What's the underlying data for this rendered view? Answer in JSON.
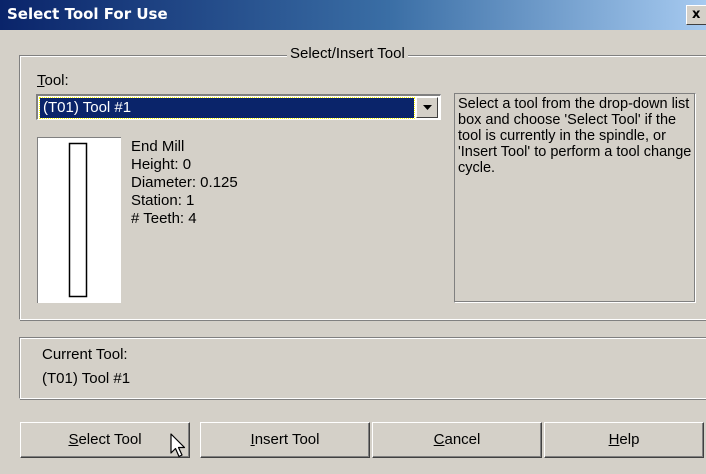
{
  "window": {
    "title": "Select Tool For Use",
    "close_glyph": "x"
  },
  "group": {
    "legend": "Select/Insert Tool"
  },
  "tool_field": {
    "label_mnemonic": "T",
    "label_rest": "ool:",
    "selected": "(T01) Tool #1"
  },
  "tool_info": {
    "type": "End Mill",
    "height": "Height: 0",
    "diameter": "Diameter: 0.125",
    "station": "Station: 1",
    "teeth": "# Teeth: 4"
  },
  "help_text": "Select a tool from the drop-down list box and choose 'Select Tool' if the tool is currently in the spindle, or 'Insert Tool' to perform a tool change cycle.",
  "current_tool": {
    "label": "Current Tool:",
    "value": "(T01) Tool #1"
  },
  "buttons": {
    "select": {
      "mnemonic": "S",
      "rest": "elect Tool"
    },
    "insert": {
      "mnemonic": "I",
      "rest": "nsert Tool"
    },
    "cancel": {
      "mnemonic": "C",
      "rest": "ancel"
    },
    "help": {
      "mnemonic": "H",
      "rest": "elp"
    }
  },
  "icons": {
    "dropdown": "chevron-down-icon",
    "cursor": "mouse-pointer-icon",
    "tool_preview": "end-mill-icon"
  },
  "colors": {
    "titlebar_start": "#0a246a",
    "titlebar_end": "#a6caf0",
    "face": "#d4d0c8",
    "selection": "#0a246a"
  }
}
